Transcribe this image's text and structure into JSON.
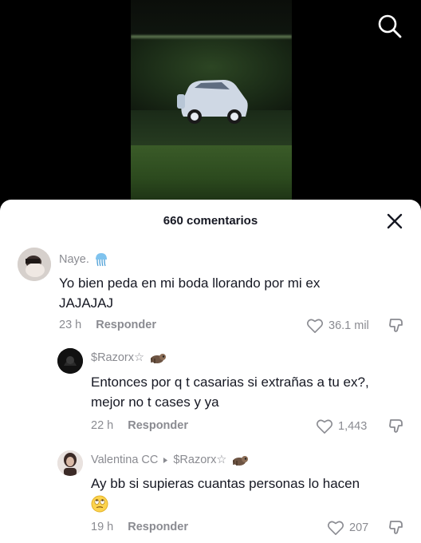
{
  "sheet": {
    "comment_count": "660 comentarios"
  },
  "comments": [
    {
      "username": "Naye.",
      "badge_icon": "jellyfish-emoji",
      "text": "Yo bien peda en mi boda llorando por mi ex JAJAJAJ",
      "time": "23 h",
      "reply_label": "Responder",
      "likes": "36.1 mil"
    },
    {
      "username": "$Razorx☆",
      "badge_icon": "sloth-emoji",
      "text": "Entonces por q t casarias si extrañas a tu ex?, mejor no t cases y ya",
      "time": "22 h",
      "reply_label": "Responder",
      "likes": "1,443"
    },
    {
      "username": "Valentina CC",
      "reply_to": "$Razorx☆",
      "badge_icon": "sloth-emoji",
      "text": "Ay bb si supieras cuantas personas lo hacen",
      "emoji_icon": "rolling-eyes-emoji",
      "time": "19 h",
      "reply_label": "Responder",
      "likes": "207"
    }
  ],
  "colors": {
    "sheet_bg": "#ffffff",
    "text_primary": "#161823",
    "text_secondary": "#8a8b91"
  }
}
